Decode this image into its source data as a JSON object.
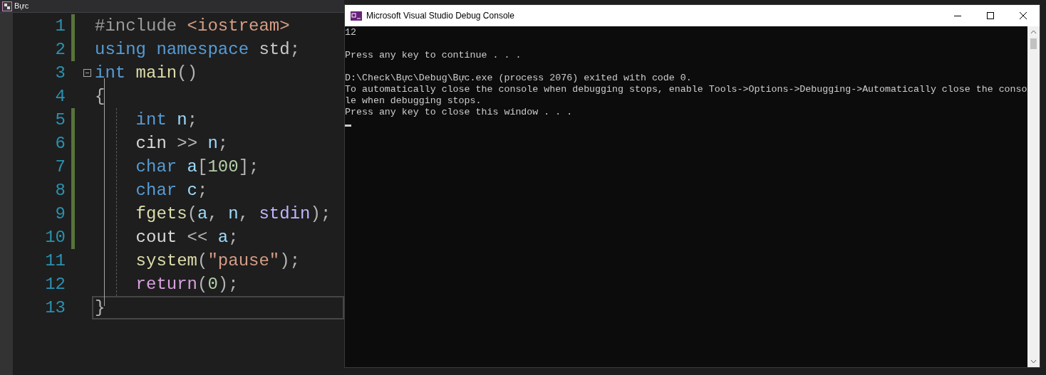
{
  "editor": {
    "tab": {
      "title": "Bực"
    },
    "lines": [
      {
        "number": "1",
        "modified": true,
        "collapsible": false,
        "current": false,
        "tokens": [
          {
            "text": "#include",
            "kind": "pp"
          },
          {
            "text": " <iostream>",
            "kind": "inc"
          }
        ]
      },
      {
        "number": "2",
        "modified": true,
        "collapsible": false,
        "current": false,
        "tokens": [
          {
            "text": "using",
            "kind": "kw"
          },
          {
            "text": " namespace",
            "kind": "kw"
          },
          {
            "text": " std",
            "kind": "ns"
          },
          {
            "text": ";",
            "kind": "punc"
          }
        ]
      },
      {
        "number": "3",
        "modified": false,
        "collapsible": true,
        "current": false,
        "tokens": [
          {
            "text": "int",
            "kind": "kw"
          },
          {
            "text": " main",
            "kind": "fn"
          },
          {
            "text": "()",
            "kind": "punc"
          }
        ]
      },
      {
        "number": "4",
        "modified": false,
        "collapsible": false,
        "current": false,
        "tokens": [
          {
            "text": "{",
            "kind": "punc"
          }
        ]
      },
      {
        "number": "5",
        "modified": true,
        "collapsible": false,
        "current": false,
        "tokens": [
          {
            "text": "    int",
            "kind": "kw"
          },
          {
            "text": " n",
            "kind": "var"
          },
          {
            "text": ";",
            "kind": "punc"
          }
        ]
      },
      {
        "number": "6",
        "modified": true,
        "collapsible": false,
        "current": false,
        "tokens": [
          {
            "text": "    cin",
            "kind": "plain"
          },
          {
            "text": " >>",
            "kind": "punc"
          },
          {
            "text": " n",
            "kind": "var"
          },
          {
            "text": ";",
            "kind": "punc"
          }
        ]
      },
      {
        "number": "7",
        "modified": true,
        "collapsible": false,
        "current": false,
        "tokens": [
          {
            "text": "    char",
            "kind": "kw"
          },
          {
            "text": " a",
            "kind": "var"
          },
          {
            "text": "[",
            "kind": "punc"
          },
          {
            "text": "100",
            "kind": "num"
          },
          {
            "text": "];",
            "kind": "punc"
          }
        ]
      },
      {
        "number": "8",
        "modified": true,
        "collapsible": false,
        "current": false,
        "tokens": [
          {
            "text": "    char",
            "kind": "kw"
          },
          {
            "text": " c",
            "kind": "var"
          },
          {
            "text": ";",
            "kind": "punc"
          }
        ]
      },
      {
        "number": "9",
        "modified": true,
        "collapsible": false,
        "current": false,
        "tokens": [
          {
            "text": "    fgets",
            "kind": "fn"
          },
          {
            "text": "(",
            "kind": "punc"
          },
          {
            "text": "a",
            "kind": "var"
          },
          {
            "text": ",",
            "kind": "punc"
          },
          {
            "text": " n",
            "kind": "var"
          },
          {
            "text": ", ",
            "kind": "punc"
          },
          {
            "text": "stdin",
            "kind": "macro"
          },
          {
            "text": ");",
            "kind": "punc"
          }
        ]
      },
      {
        "number": "10",
        "modified": true,
        "collapsible": false,
        "current": false,
        "tokens": [
          {
            "text": "    cout",
            "kind": "plain"
          },
          {
            "text": " <<",
            "kind": "punc"
          },
          {
            "text": " a",
            "kind": "var"
          },
          {
            "text": ";",
            "kind": "punc"
          }
        ]
      },
      {
        "number": "11",
        "modified": false,
        "collapsible": false,
        "current": false,
        "tokens": [
          {
            "text": "    system",
            "kind": "fn"
          },
          {
            "text": "(",
            "kind": "punc"
          },
          {
            "text": "\"pause\"",
            "kind": "str"
          },
          {
            "text": ");",
            "kind": "punc"
          }
        ]
      },
      {
        "number": "12",
        "modified": false,
        "collapsible": false,
        "current": false,
        "tokens": [
          {
            "text": "    return",
            "kind": "ctl"
          },
          {
            "text": "(",
            "kind": "punc"
          },
          {
            "text": "0",
            "kind": "num"
          },
          {
            "text": ");",
            "kind": "punc"
          }
        ]
      },
      {
        "number": "13",
        "modified": false,
        "collapsible": false,
        "current": true,
        "tokens": [
          {
            "text": "}",
            "kind": "punc"
          }
        ]
      }
    ]
  },
  "console": {
    "title": "Microsoft Visual Studio Debug Console",
    "blocks": [
      [
        "12"
      ],
      [
        "Press any key to continue . . ."
      ],
      [
        "D:\\Check\\Bực\\Debug\\Bực.exe (process 2076) exited with code 0.",
        "To automatically close the console when debugging stops, enable Tools->Options->Debugging->Automatically close the conso",
        "le when debugging stops.",
        "Press any key to close this window . . ."
      ]
    ]
  }
}
